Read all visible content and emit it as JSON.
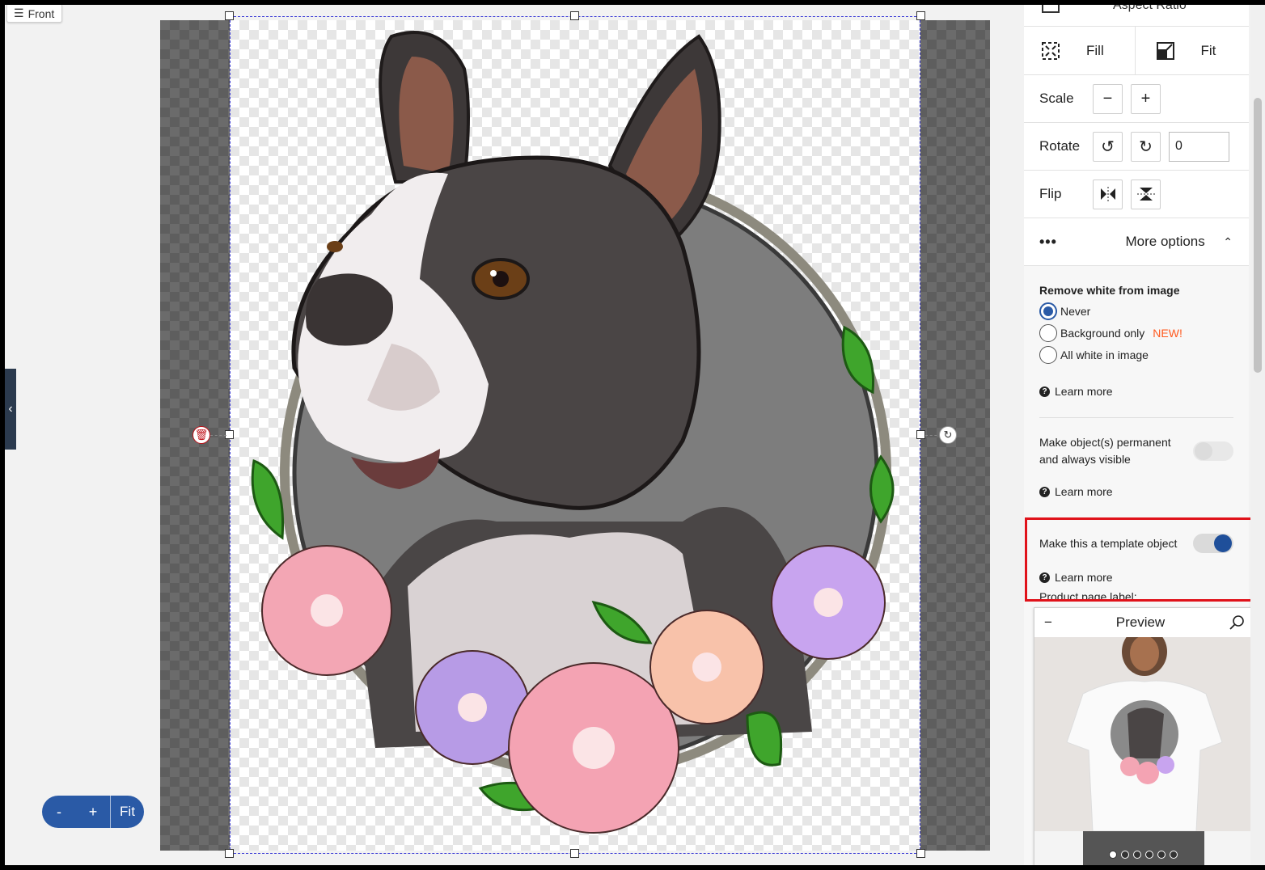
{
  "canvas": {
    "side_label": "Front",
    "zoom": {
      "minus": "-",
      "plus": "+",
      "fit": "Fit"
    }
  },
  "panel": {
    "aspect_ratio_label": "Aspect Ratio",
    "fill_label": "Fill",
    "fit_label": "Fit",
    "scale_label": "Scale",
    "rotate_label": "Rotate",
    "rotate_value": "0",
    "flip_label": "Flip",
    "more_options_dots": "•••",
    "more_options_label": "More options",
    "remove_white": {
      "title": "Remove white from image",
      "options": [
        "Never",
        "Background only",
        "All white in image"
      ],
      "selected": "Never",
      "new_tag": "NEW!"
    },
    "learn_more": "Learn more",
    "permanent_label": "Make object(s) permanent and always visible",
    "permanent_on": false,
    "template_label": "Make this a template object",
    "template_on": true,
    "product_page_label": "Product page label:"
  },
  "preview": {
    "title": "Preview",
    "collapse": "−",
    "slides": 6,
    "active_slide": 1
  },
  "colors": {
    "accent": "#2a5aa6",
    "highlight": "#e0121a",
    "new_tag": "#ff5a1f"
  }
}
